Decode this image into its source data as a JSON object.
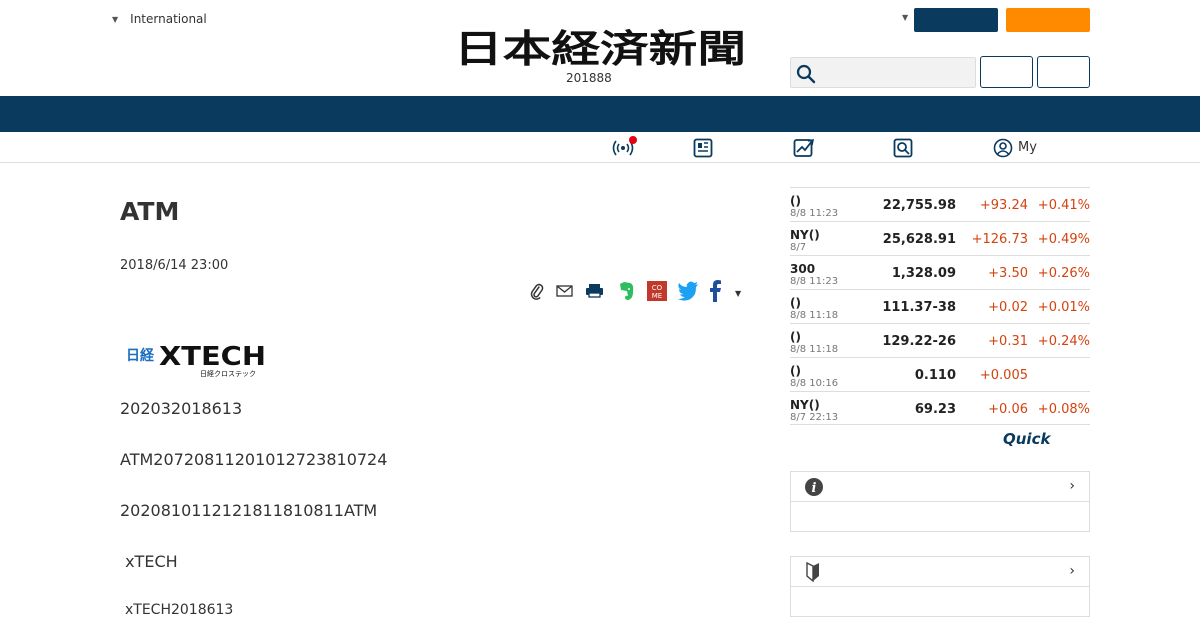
{
  "header": {
    "region_label": "International",
    "logo_text": "日本経済新聞",
    "logo_sub": "201888"
  },
  "subnav": {
    "items": [
      "live-icon",
      "paper-icon",
      "chart-icon",
      "search-icon"
    ],
    "my_label": "My"
  },
  "article": {
    "title": "ATM",
    "date": "2018/6/14 23:00",
    "source_logo_jp": "日経",
    "source_logo_en": "XTECH",
    "source_logo_kana": "日経クロステック",
    "paragraphs": [
      "202032018613",
      "ATM20720811201012723810724",
      "2020810112121811810811ATM",
      " xTECH",
      "xTECH2018613"
    ]
  },
  "share": {
    "icons": [
      "clip-icon",
      "mail-icon",
      "print-icon",
      "evernote-icon",
      "come-icon",
      "twitter-icon",
      "facebook-icon",
      "more-caret-icon"
    ],
    "come_text": "COME"
  },
  "market": {
    "rows": [
      {
        "name": "()",
        "time": "8/8 11:23",
        "value": "22,755.98",
        "change": "+93.24",
        "pct": "+0.41%"
      },
      {
        "name": "NY()",
        "time": "8/7",
        "value": "25,628.91",
        "change": "+126.73",
        "pct": "+0.49%"
      },
      {
        "name": "300",
        "time": "8/8 11:23",
        "value": "1,328.09",
        "change": "+3.50",
        "pct": "+0.26%"
      },
      {
        "name": "()",
        "time": "8/8 11:18",
        "value": "111.37-38",
        "change": "+0.02",
        "pct": "+0.01%"
      },
      {
        "name": "()",
        "time": "8/8 11:18",
        "value": "129.22-26",
        "change": "+0.31",
        "pct": "+0.24%"
      },
      {
        "name": "()",
        "time": "8/8 10:16",
        "value": "0.110",
        "change": "+0.005",
        "pct": ""
      },
      {
        "name": "NY()",
        "time": "8/7 22:13",
        "value": "69.23",
        "change": "+0.06",
        "pct": "+0.08%"
      }
    ],
    "quick_label": "Quick"
  },
  "boxes": [
    {
      "icon": "info-icon",
      "chevron": "›"
    },
    {
      "icon": "beginner-mark-icon",
      "chevron": "›"
    }
  ],
  "colors": {
    "navy": "#0b3a5f",
    "orange": "#ff8a00",
    "up": "#d4430f",
    "alert": "#e60012"
  }
}
